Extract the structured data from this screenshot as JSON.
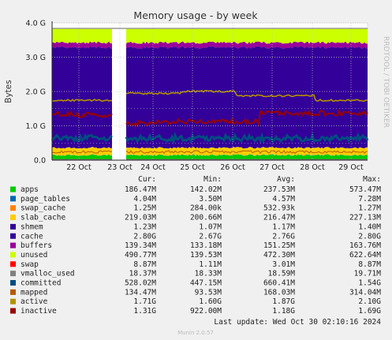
{
  "chart_data": {
    "type": "area",
    "title": "Memory usage - by week",
    "ylabel": "Bytes",
    "side_label": "RRDTOOL / TOBI OETIKER",
    "footer": "Munin 2.0.57",
    "last_update": "Last update: Wed Oct 30 02:10:16 2024",
    "yticks": [
      "0.0",
      "1.0 G",
      "2.0 G",
      "3.0 G",
      "4.0 G"
    ],
    "ylim": [
      0,
      4.0
    ],
    "xticks": [
      "22 Oct",
      "23 Oct",
      "24 Oct",
      "25 Oct",
      "26 Oct",
      "27 Oct",
      "28 Oct",
      "29 Oct"
    ],
    "gap_position": "between 22 Oct and 23 Oct",
    "columns": [
      "Cur:",
      "Min:",
      "Avg:",
      "Max:"
    ],
    "series": [
      {
        "name": "apps",
        "color": "#00cc00",
        "cur": "186.47M",
        "min": "142.02M",
        "avg": "237.53M",
        "max": "573.47M"
      },
      {
        "name": "page_tables",
        "color": "#0066b3",
        "cur": "4.04M",
        "min": "3.50M",
        "avg": "4.57M",
        "max": "7.28M"
      },
      {
        "name": "swap_cache",
        "color": "#ff8000",
        "cur": "1.25M",
        "min": "284.00k",
        "avg": "532.93k",
        "max": "1.27M"
      },
      {
        "name": "slab_cache",
        "color": "#ffcc00",
        "cur": "219.03M",
        "min": "200.66M",
        "avg": "216.47M",
        "max": "227.13M"
      },
      {
        "name": "shmem",
        "color": "#330099",
        "cur": "1.23M",
        "min": "1.07M",
        "avg": "1.17M",
        "max": "1.40M"
      },
      {
        "name": "cache",
        "color": "#330099",
        "cur": "2.80G",
        "min": "2.67G",
        "avg": "2.76G",
        "max": "2.80G"
      },
      {
        "name": "buffers",
        "color": "#990099",
        "cur": "139.34M",
        "min": "133.18M",
        "avg": "151.25M",
        "max": "163.76M"
      },
      {
        "name": "unused",
        "color": "#ccff00",
        "cur": "490.77M",
        "min": "139.53M",
        "avg": "472.30M",
        "max": "622.64M"
      },
      {
        "name": "swap",
        "color": "#ff0000",
        "cur": "8.87M",
        "min": "1.11M",
        "avg": "3.01M",
        "max": "8.87M"
      },
      {
        "name": "vmalloc_used",
        "color": "#808080",
        "cur": "18.37M",
        "min": "18.33M",
        "avg": "18.59M",
        "max": "19.71M"
      },
      {
        "name": "committed",
        "color": "#004d80",
        "cur": "528.02M",
        "min": "447.15M",
        "avg": "660.41M",
        "max": "1.54G"
      },
      {
        "name": "mapped",
        "color": "#b35a00",
        "cur": "134.47M",
        "min": "93.53M",
        "avg": "168.03M",
        "max": "314.04M"
      },
      {
        "name": "active",
        "color": "#b39100",
        "cur": "1.71G",
        "min": "1.60G",
        "avg": "1.87G",
        "max": "2.10G"
      },
      {
        "name": "inactive",
        "color": "#990000",
        "cur": "1.31G",
        "min": "922.00M",
        "avg": "1.18G",
        "max": "1.69G"
      }
    ]
  }
}
